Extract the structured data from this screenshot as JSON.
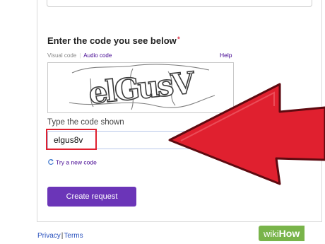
{
  "captcha": {
    "heading": "Enter the code you see below",
    "required_mark": "*",
    "tab_visual": "Visual code",
    "tab_audio": "Audio code",
    "help": "Help",
    "image_text": "elGusV",
    "type_label": "Type the code shown",
    "input_value": "elgus8v",
    "try_new": "Try a new code"
  },
  "actions": {
    "create_request": "Create request"
  },
  "footer": {
    "privacy": "Privacy",
    "separator": "|",
    "terms": "Terms"
  },
  "watermark": {
    "wiki": "wiki",
    "how": "How"
  },
  "colors": {
    "accent": "#6b35b8",
    "link": "#400090",
    "arrow": "#e0202f",
    "highlight": "#e0202f",
    "watermark": "#79b44a"
  }
}
